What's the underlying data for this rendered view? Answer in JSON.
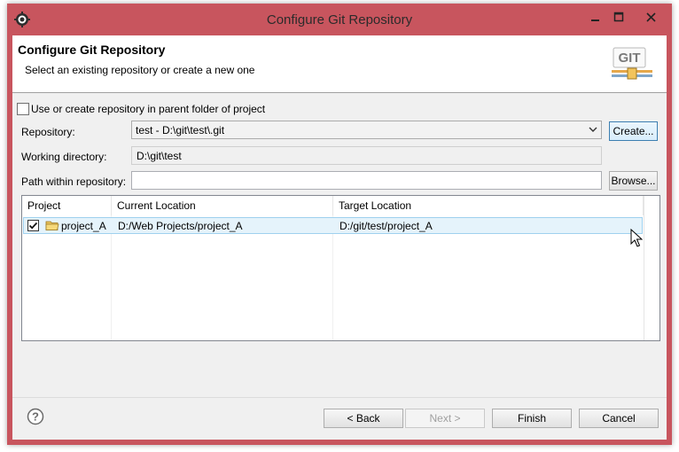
{
  "window": {
    "title": "Configure Git Repository"
  },
  "banner": {
    "title": "Configure Git Repository",
    "subtitle": "Select an existing repository or create a new one",
    "logo_text": "GIT"
  },
  "options": {
    "use_parent_label": "Use or create repository in parent folder of project",
    "use_parent_checked": false
  },
  "form": {
    "repository_label": "Repository:",
    "repository_value": "test - D:\\git\\test\\.git",
    "create_label": "Create...",
    "working_dir_label": "Working directory:",
    "working_dir_value": "D:\\git\\test",
    "path_label": "Path within repository:",
    "path_value": "",
    "browse_label": "Browse..."
  },
  "table": {
    "headers": [
      "Project",
      "Current Location",
      "Target Location"
    ],
    "rows": [
      {
        "project": "project_A",
        "checked": true,
        "current": "D:/Web Projects/project_A",
        "target": "D:/git/test/project_A"
      }
    ]
  },
  "footer": {
    "back_label": "< Back",
    "next_label": "Next >",
    "finish_label": "Finish",
    "cancel_label": "Cancel"
  },
  "colors": {
    "frame": "#c8555e",
    "row_selected": "#e5f3fb"
  },
  "icons": [
    "eclipse-gear-icon",
    "minimize-icon",
    "maximize-icon",
    "close-icon",
    "git-logo-icon",
    "folder-icon",
    "help-icon",
    "mouse-cursor-icon"
  ]
}
